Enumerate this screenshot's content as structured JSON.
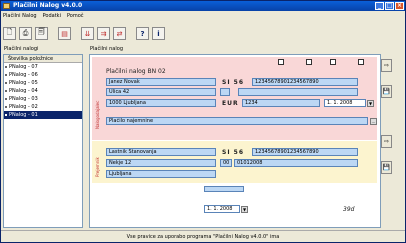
{
  "window": {
    "title": "Plačilni Nalog v4.0.0"
  },
  "menu": [
    "Plačilni Nalog",
    "Podatki",
    "Pomoč"
  ],
  "left_panel": {
    "title": "Plačilni nalogi",
    "header": "Številka položnice",
    "items": [
      "PNalog - 07",
      "PNalog - 06",
      "PNalog - 05",
      "PNalog - 04",
      "PNalog - 03",
      "PNalog - 02",
      "PNalog - 01"
    ],
    "selected_index": 6
  },
  "form": {
    "panel_title": "Plačilni nalog",
    "heading": "Plačilni nalog BN 02",
    "payer_label": "Nalogodajalec",
    "recipient_label": "Prejemnik",
    "payer_name": "Janez Novak",
    "payer_street": "Ulica 42",
    "payer_city": "1000 Ljubljana",
    "payer_code": "SI 56",
    "payer_account": "12345678901234567890",
    "currency": "EUR",
    "amount": "1234",
    "date": "1. 1. 2008",
    "purpose": "Plačilo najemnine",
    "recipient_name": "Lastnik Stanovanja",
    "recipient_street": "Nekje 12",
    "recipient_city": "Ljubljana",
    "recipient_code": "SI 56",
    "recipient_account": "12345678901234567890",
    "reference_model": "00",
    "reference": "01012008",
    "bottom_date": "1. 1. 2008",
    "bottom_code": "39d"
  },
  "status": "Vse pravice za uporabo programa \"Plačilni Nalog v4.0.0\" ima"
}
